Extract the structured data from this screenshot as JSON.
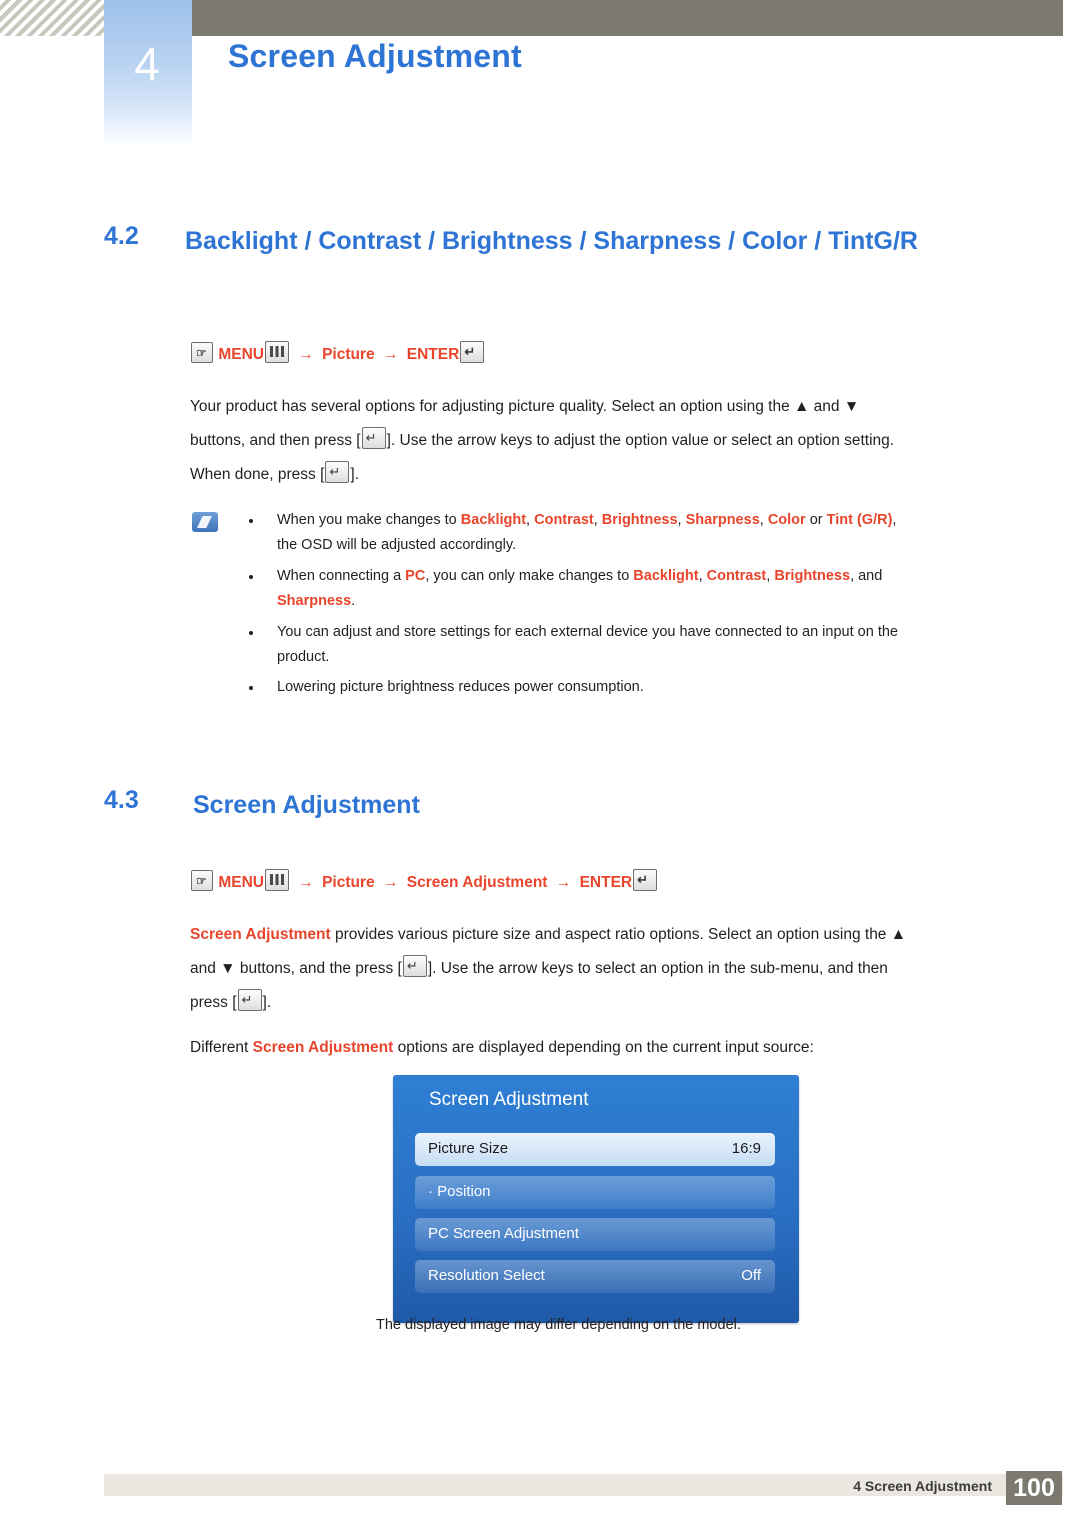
{
  "header": {
    "chapter_number": "4",
    "chapter_title": "Screen Adjustment"
  },
  "section_42": {
    "number": "4.2",
    "title": "Backlight / Contrast / Brightness / Sharpness / Color / TintG/R",
    "path": {
      "menu_label": "MENU",
      "arrow": "→",
      "picture": "Picture",
      "enter": "ENTER"
    },
    "paragraph": {
      "line1_a": "Your product has several options for adjusting picture quality. Select an option using the ",
      "line1_up": "▲",
      "line1_b": " and ",
      "line1_down": "▼",
      "line2_a": "buttons, and then press [",
      "line2_b": "]. Use the arrow keys to adjust the option value or select an option setting.",
      "line3_a": "When done, press [",
      "line3_b": "]."
    },
    "notes": [
      {
        "segments": [
          {
            "t": "When you make changes to ",
            "hl": false
          },
          {
            "t": "Backlight",
            "hl": true
          },
          {
            "t": ", ",
            "hl": false
          },
          {
            "t": "Contrast",
            "hl": true
          },
          {
            "t": ", ",
            "hl": false
          },
          {
            "t": "Brightness",
            "hl": true
          },
          {
            "t": ", ",
            "hl": false
          },
          {
            "t": "Sharpness",
            "hl": true
          },
          {
            "t": ", ",
            "hl": false
          },
          {
            "t": "Color",
            "hl": true
          },
          {
            "t": " or ",
            "hl": false
          },
          {
            "t": "Tint (G/R)",
            "hl": true
          },
          {
            "t": ",",
            "hl": false
          }
        ],
        "line2": "the OSD will be adjusted accordingly."
      },
      {
        "segments": [
          {
            "t": "When connecting a ",
            "hl": false
          },
          {
            "t": "PC",
            "hl": true
          },
          {
            "t": ", you can only make changes to ",
            "hl": false
          },
          {
            "t": "Backlight",
            "hl": true
          },
          {
            "t": ", ",
            "hl": false
          },
          {
            "t": "Contrast",
            "hl": true
          },
          {
            "t": ", ",
            "hl": false
          },
          {
            "t": "Brightness",
            "hl": true
          },
          {
            "t": ", and",
            "hl": false
          }
        ],
        "line2_segments": [
          {
            "t": "Sharpness",
            "hl": true
          },
          {
            "t": ".",
            "hl": false
          }
        ]
      },
      {
        "segments": [
          {
            "t": "You can adjust and store settings for each external device you have connected to an input on the",
            "hl": false
          }
        ],
        "line2": "product."
      },
      {
        "segments": [
          {
            "t": "Lowering picture brightness reduces power consumption.",
            "hl": false
          }
        ]
      }
    ]
  },
  "section_43": {
    "number": "4.3",
    "title": "Screen Adjustment",
    "path": {
      "menu_label": "MENU",
      "arrow": "→",
      "picture": "Picture",
      "screen_adjustment": "Screen Adjustment",
      "enter": "ENTER"
    },
    "paragraph": {
      "p1_a": "Screen Adjustment",
      "p1_b": " provides various picture size and aspect ratio options. Select an option using the ",
      "p1_up": "▲",
      "p2_down": "▼",
      "p2_a": "and ",
      "p2_b": " buttons, and the press [",
      "p2_c": "]. Use the arrow keys to select an option in the sub-menu, and then",
      "p3_a": "press [",
      "p3_b": "]."
    },
    "note_line": {
      "a": "Different ",
      "b": "Screen Adjustment",
      "c": " options are displayed depending on the current input source:"
    },
    "caption": "The displayed image may differ depending on the model."
  },
  "osd": {
    "title": "Screen Adjustment",
    "rows": [
      {
        "label": "Picture Size",
        "value": "16:9",
        "selected": true
      },
      {
        "label": "· Position",
        "value": "",
        "selected": false
      },
      {
        "label": "PC Screen Adjustment",
        "value": "",
        "selected": false
      },
      {
        "label": "Resolution Select",
        "value": "Off",
        "selected": false
      }
    ]
  },
  "footer": {
    "text": "4 Screen Adjustment",
    "page": "100"
  },
  "colors": {
    "accent_blue": "#2e74d4",
    "highlight_red": "#e8452c",
    "header_band": "#7c7a6e",
    "osd_blue": "#2a6fc4"
  }
}
